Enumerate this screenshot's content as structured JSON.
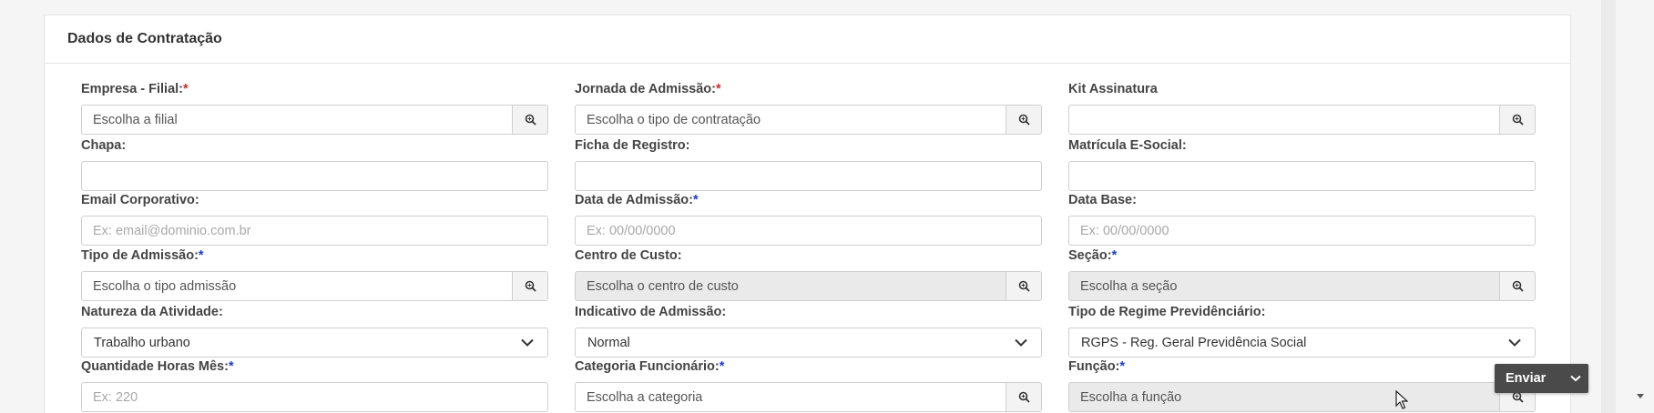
{
  "section": {
    "title": "Dados de Contratação"
  },
  "fields": {
    "empresa_filial": {
      "label": "Empresa - Filial:",
      "required": "*",
      "placeholder": "Escolha a filial"
    },
    "jornada_admissao": {
      "label": "Jornada de Admissão:",
      "required": "*",
      "placeholder": "Escolha o tipo de contratação"
    },
    "kit_assinatura": {
      "label": "Kit Assinatura",
      "placeholder": ""
    },
    "chapa": {
      "label": "Chapa:",
      "value": ""
    },
    "ficha_registro": {
      "label": "Ficha de Registro:",
      "value": ""
    },
    "matricula_esocial": {
      "label": "Matrícula E-Social:",
      "value": ""
    },
    "email_corporativo": {
      "label": "Email Corporativo:",
      "placeholder": "Ex: email@dominio.com.br"
    },
    "data_admissao": {
      "label": "Data de Admissão:",
      "required": "*",
      "placeholder": "Ex: 00/00/0000"
    },
    "data_base": {
      "label": "Data Base:",
      "placeholder": "Ex: 00/00/0000"
    },
    "tipo_admissao": {
      "label": "Tipo de Admissão:",
      "required": "*",
      "placeholder": "Escolha o tipo admissão"
    },
    "centro_custo": {
      "label": "Centro de Custo:",
      "placeholder": "Escolha o centro de custo"
    },
    "secao": {
      "label": "Seção:",
      "required": "*",
      "placeholder": "Escolha a seção"
    },
    "natureza_atividade": {
      "label": "Natureza da Atividade:",
      "value": "Trabalho urbano"
    },
    "indicativo_admissao": {
      "label": "Indicativo de Admissão:",
      "value": "Normal"
    },
    "tipo_regime": {
      "label": "Tipo de Regime Previdênciário:",
      "value": "RGPS - Reg. Geral Previdência Social"
    },
    "quantidade_horas": {
      "label": "Quantidade Horas Mês:",
      "required": "*",
      "placeholder": "Ex: 220"
    },
    "categoria_funcionario": {
      "label": "Categoria Funcionário:",
      "required": "*",
      "placeholder": "Escolha a categoria"
    },
    "funcao": {
      "label": "Função:",
      "required": "*",
      "placeholder": "Escolha a função"
    }
  },
  "actions": {
    "submit_label": "Enviar"
  },
  "colors": {
    "required_red": "#d02a2a",
    "required_blue": "#1a3bd6",
    "button_dark": "#4a4a4a"
  },
  "icons": {
    "lookup": "search-icon",
    "select": "chevron-down-icon"
  }
}
